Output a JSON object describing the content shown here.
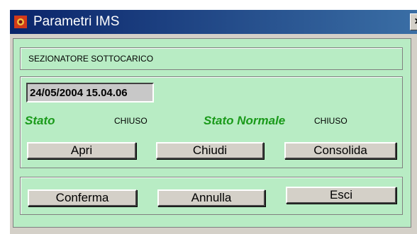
{
  "window": {
    "title": "Parametri IMS",
    "close_label": "×"
  },
  "device": {
    "type_label": "SEZIONATORE SOTTOCARICO"
  },
  "status": {
    "timestamp": "24/05/2004 15.04.06",
    "stato_label": "Stato",
    "stato_value": "CHIUSO",
    "stato_normale_label": "Stato Normale",
    "stato_normale_value": "CHIUSO"
  },
  "actions": {
    "apri": "Apri",
    "chiudi": "Chiudi",
    "consolida": "Consolida"
  },
  "footer": {
    "conferma": "Conferma",
    "annulla": "Annulla",
    "esci": "Esci"
  },
  "colors": {
    "panel_bg": "#b8ecc4",
    "label_green": "#1a9a1a",
    "title_bar": "#0a246a"
  }
}
